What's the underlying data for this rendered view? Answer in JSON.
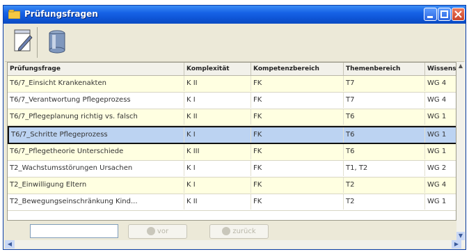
{
  "window": {
    "title": "Prüfungsfragen"
  },
  "toolbar": {
    "buttons": [
      {
        "icon": "edit-icon"
      },
      {
        "icon": "database-icon"
      }
    ]
  },
  "table": {
    "columns": [
      "Prüfungsfrage",
      "Komplexität",
      "Kompetenzbereich",
      "Themenbereich",
      "Wissens"
    ],
    "rows": [
      {
        "frage": "T6/7_Einsicht Krankenakten",
        "komplexitaet": "K II",
        "kompetenz": "FK",
        "thema": "T7",
        "wissen": "WG 4"
      },
      {
        "frage": "T6/7_Verantwortung Pflegeprozess",
        "komplexitaet": "K I",
        "kompetenz": "FK",
        "thema": "T7",
        "wissen": "WG 4"
      },
      {
        "frage": "T6/7_Pflegeplanung richtig vs. falsch",
        "komplexitaet": "K II",
        "kompetenz": "FK",
        "thema": "T6",
        "wissen": "WG 1"
      },
      {
        "frage": "T6/7_Schritte Pflegeprozess",
        "komplexitaet": "K I",
        "kompetenz": "FK",
        "thema": "T6",
        "wissen": "WG 1"
      },
      {
        "frage": "T6/7_Pflegetheorie Unterschiede",
        "komplexitaet": "K III",
        "kompetenz": "FK",
        "thema": "T6",
        "wissen": "WG 1"
      },
      {
        "frage": "T2_Wachstumsstörungen Ursachen",
        "komplexitaet": "K I",
        "kompetenz": "FK",
        "thema": "T1, T2",
        "wissen": "WG 2"
      },
      {
        "frage": "T2_Einwilligung Eltern",
        "komplexitaet": "K I",
        "kompetenz": "FK",
        "thema": "T2",
        "wissen": "WG 4"
      },
      {
        "frage": "T2_Bewegungseinschränkung Kind...",
        "komplexitaet": "K II",
        "kompetenz": "FK",
        "thema": "T2",
        "wissen": "WG 1"
      }
    ],
    "selected_row_index": 3
  },
  "navigation": {
    "page_input_value": "",
    "vor_label": "vor",
    "zurueck_label": "zurück"
  },
  "colors": {
    "titlebar": "#0e55d6",
    "selected_row": "#bcd3f2",
    "alt_row": "#ffffe1"
  }
}
